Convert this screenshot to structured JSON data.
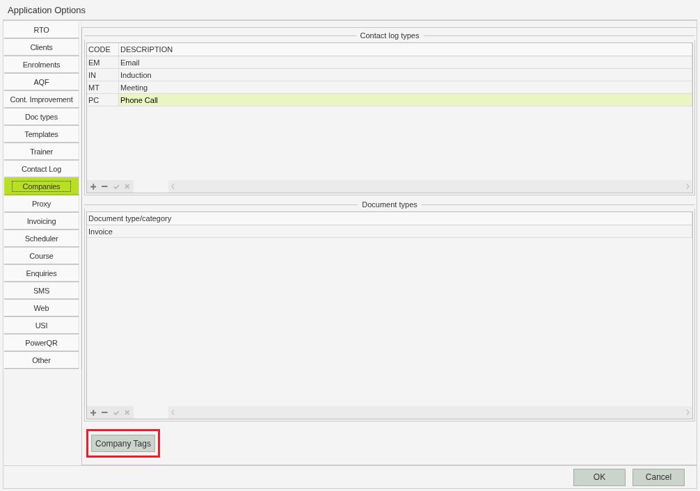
{
  "window": {
    "title": "Application Options"
  },
  "sidebar": {
    "items": [
      {
        "label": "RTO",
        "selected": false
      },
      {
        "label": "Clients",
        "selected": false
      },
      {
        "label": "Enrolments",
        "selected": false
      },
      {
        "label": "AQF",
        "selected": false
      },
      {
        "label": "Cont. Improvement",
        "selected": false
      },
      {
        "label": "Doc types",
        "selected": false
      },
      {
        "label": "Templates",
        "selected": false
      },
      {
        "label": "Trainer",
        "selected": false
      },
      {
        "label": "Contact Log",
        "selected": false
      },
      {
        "label": "Companies",
        "selected": true
      },
      {
        "label": "Proxy",
        "selected": false
      },
      {
        "label": "Invoicing",
        "selected": false
      },
      {
        "label": "Scheduler",
        "selected": false
      },
      {
        "label": "Course",
        "selected": false
      },
      {
        "label": "Enquiries",
        "selected": false
      },
      {
        "label": "SMS",
        "selected": false
      },
      {
        "label": "Web",
        "selected": false
      },
      {
        "label": "USI",
        "selected": false
      },
      {
        "label": "PowerQR",
        "selected": false
      },
      {
        "label": "Other",
        "selected": false
      }
    ]
  },
  "contact_log_types": {
    "title": "Contact log types",
    "columns": [
      "CODE",
      "DESCRIPTION"
    ],
    "rows": [
      {
        "cells": [
          "EM",
          "Email"
        ],
        "selected": false
      },
      {
        "cells": [
          "IN",
          "Induction"
        ],
        "selected": false
      },
      {
        "cells": [
          "MT",
          "Meeting"
        ],
        "selected": false
      },
      {
        "cells": [
          "PC",
          "Phone Call"
        ],
        "selected": true
      }
    ]
  },
  "document_types": {
    "title": "Document types",
    "columns": [
      "Document type/category"
    ],
    "rows": [
      {
        "cells": [
          "Invoice"
        ],
        "selected": false
      }
    ]
  },
  "company_tags_button": {
    "label": "Company Tags",
    "highlighted": true
  },
  "buttons": [
    {
      "label": "OK"
    },
    {
      "label": "Cancel"
    }
  ]
}
